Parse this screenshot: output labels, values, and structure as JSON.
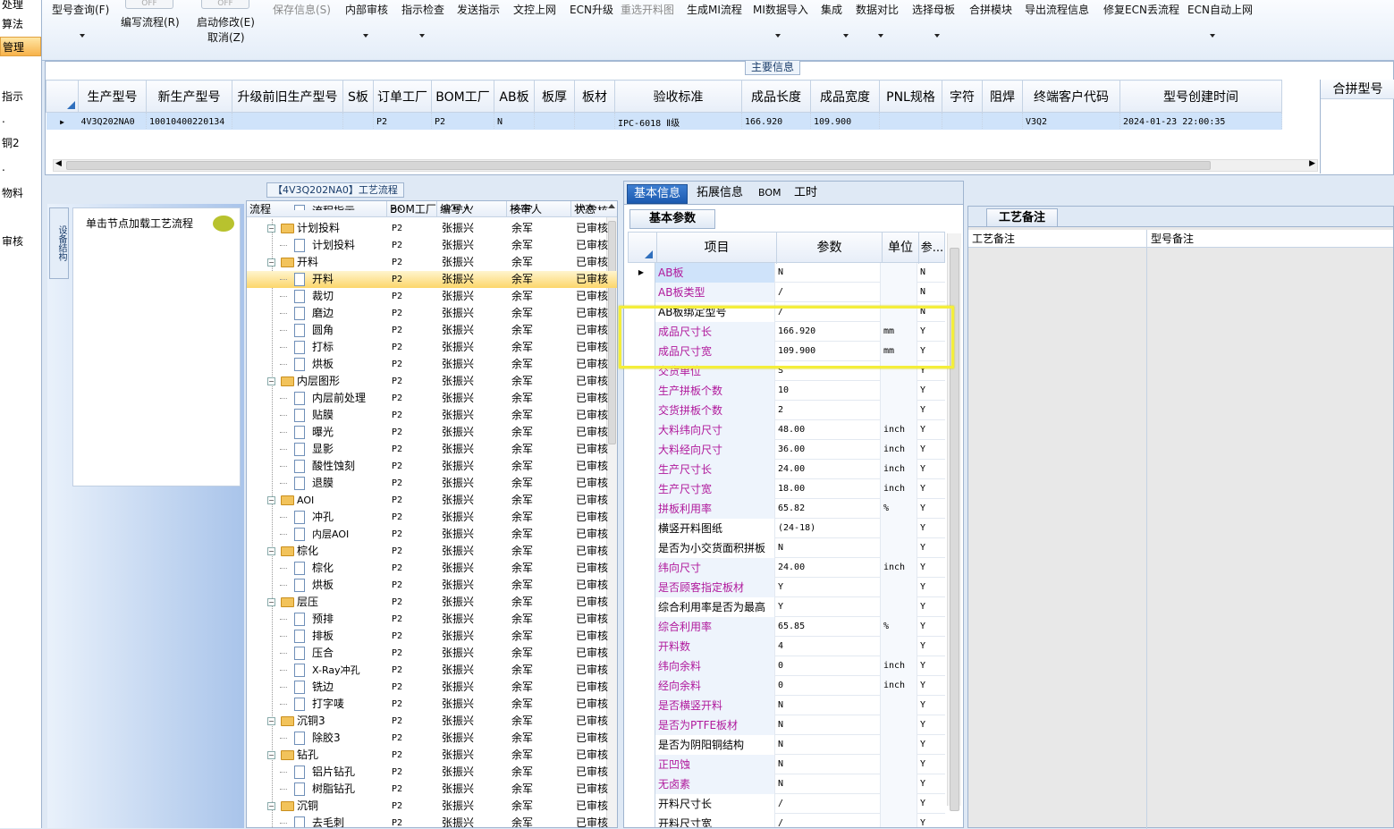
{
  "left_strip": {
    "items": [
      "处理",
      "算法",
      "管理",
      "指示",
      ".",
      "铜2",
      ".",
      "物料",
      "审核"
    ]
  },
  "toolbar": {
    "items": [
      {
        "label": "型号查询(F)",
        "dropdown": true
      },
      {
        "label": "编写流程(R)",
        "toggle": "OFF"
      },
      {
        "label": "启动修改(E)",
        "sub": "取消(Z)",
        "toggle": "OFF"
      },
      {
        "label": "保存信息(S)",
        "disabled": true
      },
      {
        "label": "内部审核",
        "dropdown": true
      },
      {
        "label": "指示检查",
        "dropdown": true
      },
      {
        "label": "发送指示"
      },
      {
        "label": "文控上网"
      },
      {
        "label": "ECN升级"
      },
      {
        "label": "重选开料图",
        "disabled": true
      },
      {
        "label": "生成MI流程"
      },
      {
        "label": "MI数据导入",
        "dropdown": true
      },
      {
        "label": "集成",
        "dropdown": true
      },
      {
        "label": "数据对比",
        "dropdown": true
      },
      {
        "label": "选择母板",
        "dropdown": true
      },
      {
        "label": "合拼模块"
      },
      {
        "label": "导出流程信息"
      },
      {
        "label": "修复ECN丢流程"
      },
      {
        "label": "ECN自动上网",
        "dropdown": true
      }
    ]
  },
  "main_info": {
    "title": "主要信息",
    "columns": [
      "生产型号",
      "新生产型号",
      "升级前旧生产型号",
      "S板",
      "订单工厂",
      "BOM工厂",
      "AB板",
      "板厚",
      "板材",
      "验收标准",
      "成品长度",
      "成品宽度",
      "PNL规格",
      "字符",
      "阻焊",
      "终端客户代码",
      "型号创建时间"
    ],
    "row": [
      "4V3Q202NA0",
      "10010400220134",
      "",
      "",
      "P2",
      "P2",
      "N",
      "",
      "",
      "IPC-6018 Ⅱ级",
      "166.920",
      "109.900",
      "",
      "",
      "",
      "V3Q2",
      "2024-01-23 22:00:35"
    ],
    "side_header": "合拼型号"
  },
  "left_nav": {
    "vertical_tab": "设备结构",
    "hint": "单击节点加载工艺流程"
  },
  "process_tree": {
    "title": "【4V3Q202NA0】工艺流程",
    "columns": [
      "流程",
      "BOM工厂",
      "编写人",
      "核审人",
      "状态"
    ],
    "rows": [
      {
        "name": "流程指示",
        "level": 1,
        "type": "doc",
        "bom": "P2",
        "writer": "张振兴",
        "reviewer": "余军",
        "status": "已审核"
      },
      {
        "name": "计划投料",
        "level": 0,
        "type": "folder",
        "bom": "P2",
        "writer": "张振兴",
        "reviewer": "余军",
        "status": "已审核"
      },
      {
        "name": "计划投料",
        "level": 1,
        "type": "doc",
        "bom": "P2",
        "writer": "张振兴",
        "reviewer": "余军",
        "status": "已审核"
      },
      {
        "name": "开料",
        "level": 0,
        "type": "folder",
        "bom": "P2",
        "writer": "张振兴",
        "reviewer": "余军",
        "status": "已审核"
      },
      {
        "name": "开料",
        "level": 1,
        "type": "doc",
        "bom": "P2",
        "writer": "张振兴",
        "reviewer": "余军",
        "status": "已审核",
        "selected": true
      },
      {
        "name": "裁切",
        "level": 1,
        "type": "doc",
        "bom": "P2",
        "writer": "张振兴",
        "reviewer": "余军",
        "status": "已审核"
      },
      {
        "name": "磨边",
        "level": 1,
        "type": "doc",
        "bom": "P2",
        "writer": "张振兴",
        "reviewer": "余军",
        "status": "已审核"
      },
      {
        "name": "圆角",
        "level": 1,
        "type": "doc",
        "bom": "P2",
        "writer": "张振兴",
        "reviewer": "余军",
        "status": "已审核"
      },
      {
        "name": "打标",
        "level": 1,
        "type": "doc",
        "bom": "P2",
        "writer": "张振兴",
        "reviewer": "余军",
        "status": "已审核"
      },
      {
        "name": "烘板",
        "level": 1,
        "type": "doc",
        "bom": "P2",
        "writer": "张振兴",
        "reviewer": "余军",
        "status": "已审核"
      },
      {
        "name": "内层图形",
        "level": 0,
        "type": "folder",
        "bom": "P2",
        "writer": "张振兴",
        "reviewer": "余军",
        "status": "已审核"
      },
      {
        "name": "内层前处理",
        "level": 1,
        "type": "doc",
        "bom": "P2",
        "writer": "张振兴",
        "reviewer": "余军",
        "status": "已审核"
      },
      {
        "name": "贴膜",
        "level": 1,
        "type": "doc",
        "bom": "P2",
        "writer": "张振兴",
        "reviewer": "余军",
        "status": "已审核"
      },
      {
        "name": "曝光",
        "level": 1,
        "type": "doc",
        "bom": "P2",
        "writer": "张振兴",
        "reviewer": "余军",
        "status": "已审核"
      },
      {
        "name": "显影",
        "level": 1,
        "type": "doc",
        "bom": "P2",
        "writer": "张振兴",
        "reviewer": "余军",
        "status": "已审核"
      },
      {
        "name": "酸性蚀刻",
        "level": 1,
        "type": "doc",
        "bom": "P2",
        "writer": "张振兴",
        "reviewer": "余军",
        "status": "已审核"
      },
      {
        "name": "退膜",
        "level": 1,
        "type": "doc",
        "bom": "P2",
        "writer": "张振兴",
        "reviewer": "余军",
        "status": "已审核"
      },
      {
        "name": "AOI",
        "level": 0,
        "type": "folder",
        "bom": "P2",
        "writer": "张振兴",
        "reviewer": "余军",
        "status": "已审核"
      },
      {
        "name": "冲孔",
        "level": 1,
        "type": "doc",
        "bom": "P2",
        "writer": "张振兴",
        "reviewer": "余军",
        "status": "已审核"
      },
      {
        "name": "内层AOI",
        "level": 1,
        "type": "doc",
        "bom": "P2",
        "writer": "张振兴",
        "reviewer": "余军",
        "status": "已审核"
      },
      {
        "name": "棕化",
        "level": 0,
        "type": "folder",
        "bom": "P2",
        "writer": "张振兴",
        "reviewer": "余军",
        "status": "已审核"
      },
      {
        "name": "棕化",
        "level": 1,
        "type": "doc",
        "bom": "P2",
        "writer": "张振兴",
        "reviewer": "余军",
        "status": "已审核"
      },
      {
        "name": "烘板",
        "level": 1,
        "type": "doc",
        "bom": "P2",
        "writer": "张振兴",
        "reviewer": "余军",
        "status": "已审核"
      },
      {
        "name": "层压",
        "level": 0,
        "type": "folder",
        "bom": "P2",
        "writer": "张振兴",
        "reviewer": "余军",
        "status": "已审核"
      },
      {
        "name": "预排",
        "level": 1,
        "type": "doc",
        "bom": "P2",
        "writer": "张振兴",
        "reviewer": "余军",
        "status": "已审核"
      },
      {
        "name": "排板",
        "level": 1,
        "type": "doc",
        "bom": "P2",
        "writer": "张振兴",
        "reviewer": "余军",
        "status": "已审核"
      },
      {
        "name": "压合",
        "level": 1,
        "type": "doc",
        "bom": "P2",
        "writer": "张振兴",
        "reviewer": "余军",
        "status": "已审核"
      },
      {
        "name": "X-Ray冲孔",
        "level": 1,
        "type": "doc",
        "bom": "P2",
        "writer": "张振兴",
        "reviewer": "余军",
        "status": "已审核"
      },
      {
        "name": "铣边",
        "level": 1,
        "type": "doc",
        "bom": "P2",
        "writer": "张振兴",
        "reviewer": "余军",
        "status": "已审核"
      },
      {
        "name": "打字唛",
        "level": 1,
        "type": "doc",
        "bom": "P2",
        "writer": "张振兴",
        "reviewer": "余军",
        "status": "已审核"
      },
      {
        "name": "沉铜3",
        "level": 0,
        "type": "folder",
        "bom": "P2",
        "writer": "张振兴",
        "reviewer": "余军",
        "status": "已审核"
      },
      {
        "name": "除胶3",
        "level": 1,
        "type": "doc",
        "bom": "P2",
        "writer": "张振兴",
        "reviewer": "余军",
        "status": "已审核"
      },
      {
        "name": "钻孔",
        "level": 0,
        "type": "folder",
        "bom": "P2",
        "writer": "张振兴",
        "reviewer": "余军",
        "status": "已审核"
      },
      {
        "name": "铝片钻孔",
        "level": 1,
        "type": "doc",
        "bom": "P2",
        "writer": "张振兴",
        "reviewer": "余军",
        "status": "已审核"
      },
      {
        "name": "树脂钻孔",
        "level": 1,
        "type": "doc",
        "bom": "P2",
        "writer": "张振兴",
        "reviewer": "余军",
        "status": "已审核"
      },
      {
        "name": "沉铜",
        "level": 0,
        "type": "folder",
        "bom": "P2",
        "writer": "张振兴",
        "reviewer": "余军",
        "status": "已审核"
      },
      {
        "name": "去毛刺",
        "level": 1,
        "type": "doc",
        "bom": "P2",
        "writer": "张振兴",
        "reviewer": "余军",
        "status": "已审核"
      }
    ]
  },
  "detail_tabs": [
    "基本信息",
    "拓展信息",
    "BOM",
    "工时"
  ],
  "basic_params": {
    "title": "基本参数",
    "columns": [
      "项目",
      "参数",
      "单位",
      "参..."
    ],
    "rows": [
      {
        "name": "AB板",
        "value": "N",
        "unit": "",
        "flag": "N",
        "pink": true
      },
      {
        "name": "AB板类型",
        "value": "/",
        "unit": "",
        "flag": "N",
        "pink": true
      },
      {
        "name": "AB板绑定型号",
        "value": "/",
        "unit": "",
        "flag": "N",
        "pink": false
      },
      {
        "name": "成品尺寸长",
        "value": "166.920",
        "unit": "mm",
        "flag": "Y",
        "pink": true
      },
      {
        "name": "成品尺寸宽",
        "value": "109.900",
        "unit": "mm",
        "flag": "Y",
        "pink": true
      },
      {
        "name": "交货单位",
        "value": "S",
        "unit": "",
        "flag": "Y",
        "pink": true
      },
      {
        "name": "生产拼板个数",
        "value": "10",
        "unit": "",
        "flag": "Y",
        "pink": true
      },
      {
        "name": "交货拼板个数",
        "value": "2",
        "unit": "",
        "flag": "Y",
        "pink": true
      },
      {
        "name": "大料纬向尺寸",
        "value": "48.00",
        "unit": "inch",
        "flag": "Y",
        "pink": true
      },
      {
        "name": "大料经向尺寸",
        "value": "36.00",
        "unit": "inch",
        "flag": "Y",
        "pink": true
      },
      {
        "name": "生产尺寸长",
        "value": "24.00",
        "unit": "inch",
        "flag": "Y",
        "pink": true
      },
      {
        "name": "生产尺寸宽",
        "value": "18.00",
        "unit": "inch",
        "flag": "Y",
        "pink": true
      },
      {
        "name": "拼板利用率",
        "value": "65.82",
        "unit": "%",
        "flag": "Y",
        "pink": true
      },
      {
        "name": "横竖开料图纸",
        "value": "(24-18)",
        "unit": "",
        "flag": "Y",
        "pink": false
      },
      {
        "name": "是否为小交货面积拼板",
        "value": "N",
        "unit": "",
        "flag": "Y",
        "pink": false
      },
      {
        "name": "纬向尺寸",
        "value": "24.00",
        "unit": "inch",
        "flag": "Y",
        "pink": true
      },
      {
        "name": "是否顾客指定板材",
        "value": "Y",
        "unit": "",
        "flag": "Y",
        "pink": true
      },
      {
        "name": "综合利用率是否为最高",
        "value": "Y",
        "unit": "",
        "flag": "Y",
        "pink": false
      },
      {
        "name": "综合利用率",
        "value": "65.85",
        "unit": "%",
        "flag": "Y",
        "pink": true
      },
      {
        "name": "开料数",
        "value": "4",
        "unit": "",
        "flag": "Y",
        "pink": true
      },
      {
        "name": "纬向余料",
        "value": "0",
        "unit": "inch",
        "flag": "Y",
        "pink": true
      },
      {
        "name": "经向余料",
        "value": "0",
        "unit": "inch",
        "flag": "Y",
        "pink": true
      },
      {
        "name": "是否横竖开料",
        "value": "N",
        "unit": "",
        "flag": "Y",
        "pink": true
      },
      {
        "name": "是否为PTFE板材",
        "value": "N",
        "unit": "",
        "flag": "Y",
        "pink": true
      },
      {
        "name": "是否为阴阳铜结构",
        "value": "N",
        "unit": "",
        "flag": "Y",
        "pink": false
      },
      {
        "name": "正凹蚀",
        "value": "N",
        "unit": "",
        "flag": "Y",
        "pink": true
      },
      {
        "name": "无卤素",
        "value": "N",
        "unit": "",
        "flag": "Y",
        "pink": true
      },
      {
        "name": "开料尺寸长",
        "value": "/",
        "unit": "",
        "flag": "Y",
        "pink": false
      },
      {
        "name": "开料尺寸宽",
        "value": "/",
        "unit": "",
        "flag": "Y",
        "pink": false
      }
    ]
  },
  "notes": {
    "tab": "工艺备注",
    "col1": "工艺备注",
    "col2": "型号备注"
  },
  "colors": {
    "pink_text": "#b0199c",
    "highlight": "#f4ee3a",
    "selected_row": "#cfe3fa",
    "tab_active": "#1c5ab0"
  }
}
